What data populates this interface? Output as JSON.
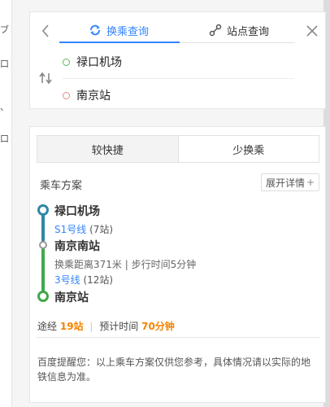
{
  "left_strip": {
    "glyphs": [
      "ブ",
      "口",
      "、",
      "口"
    ]
  },
  "search_panel": {
    "tabs": [
      {
        "label": "换乘查询",
        "icon": "transit-loop-icon",
        "active": true
      },
      {
        "label": "站点查询",
        "icon": "station-node-icon",
        "active": false
      }
    ],
    "start_point": "禄口机场",
    "end_point": "南京站"
  },
  "results": {
    "segments": [
      {
        "label": "较快捷",
        "active": true
      },
      {
        "label": "少换乘",
        "active": false
      }
    ],
    "plan_title": "乘车方案",
    "expand_label": "展开详情",
    "expand_symbol": "+",
    "route": {
      "origin": "禄口机场",
      "leg1": {
        "line": "S1号线",
        "stations": "(7站)",
        "color": "#2f87a5"
      },
      "transfer_station": "南京南站",
      "transfer_note": "换乘距离371米 | 步行时间5分钟",
      "leg2": {
        "line": "3号线",
        "stations": "(12站)",
        "color": "#40a84a"
      },
      "destination": "南京站"
    },
    "summary": {
      "via_prefix": "途经",
      "stations": "19站",
      "separator": "|",
      "time_prefix": "预计时间",
      "time": "70分钟"
    },
    "tip": "百度提醒您：以上乘车方案仅供您参考，具体情况请以实际的地铁信息为准。"
  },
  "colors": {
    "accent": "#3385ff",
    "highlight": "#f58300"
  }
}
